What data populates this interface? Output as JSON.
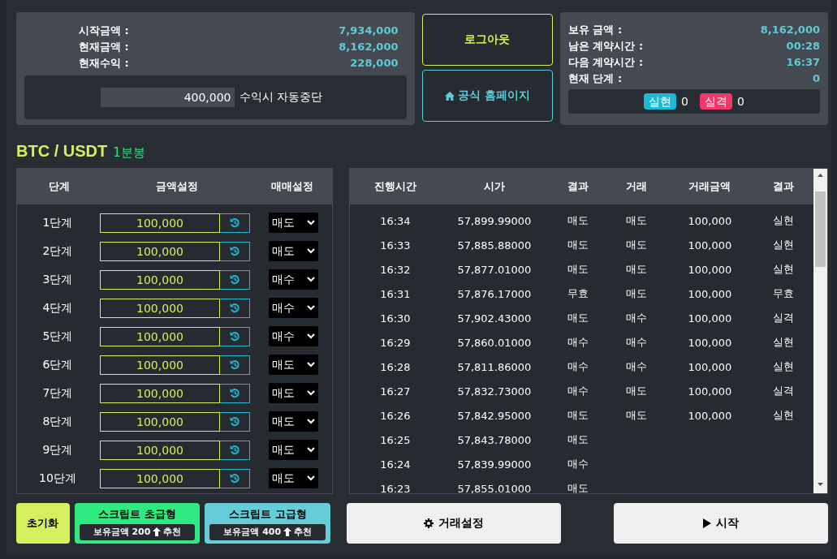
{
  "summary": {
    "rows": [
      {
        "label": "시작금액 :",
        "value": "7,934,000"
      },
      {
        "label": "현재금액 :",
        "value": "8,162,000"
      },
      {
        "label": "현재수익 :",
        "value": "228,000"
      }
    ],
    "auto_stop": {
      "value": "400,000",
      "label": "수익시 자동중단"
    }
  },
  "actions": {
    "logout": "로그아웃",
    "homepage": "공식 홈페이지"
  },
  "status": {
    "rows": [
      {
        "label": "보유 금액 :",
        "value": "8,162,000"
      },
      {
        "label": "남은 계약시간 :",
        "value": "00:28"
      },
      {
        "label": "다음 계약시간 :",
        "value": "16:37"
      },
      {
        "label": "현재 단계 :",
        "value": "0"
      }
    ],
    "badges": [
      {
        "label": "실현",
        "count": "0",
        "color": "#1eb9d2"
      },
      {
        "label": "실격",
        "count": "0",
        "color": "#f2386a"
      }
    ]
  },
  "pair": {
    "symbol": "BTC / USDT",
    "interval": "1분봉"
  },
  "steps": {
    "columns": [
      "단계",
      "금액설정",
      "매매설정"
    ],
    "rows": [
      {
        "step": "1단계",
        "amount": "100,000",
        "trade": "매도"
      },
      {
        "step": "2단계",
        "amount": "100,000",
        "trade": "매도"
      },
      {
        "step": "3단계",
        "amount": "100,000",
        "trade": "매수"
      },
      {
        "step": "4단계",
        "amount": "100,000",
        "trade": "매수"
      },
      {
        "step": "5단계",
        "amount": "100,000",
        "trade": "매수"
      },
      {
        "step": "6단계",
        "amount": "100,000",
        "trade": "매도"
      },
      {
        "step": "7단계",
        "amount": "100,000",
        "trade": "매도"
      },
      {
        "step": "8단계",
        "amount": "100,000",
        "trade": "매도"
      },
      {
        "step": "9단계",
        "amount": "100,000",
        "trade": "매도"
      },
      {
        "step": "10단계",
        "amount": "100,000",
        "trade": "매도"
      }
    ]
  },
  "history": {
    "columns": [
      "진행시간",
      "시가",
      "결과",
      "거래",
      "거래금액",
      "결과"
    ],
    "rows": [
      [
        "16:34",
        "57,899.99000",
        "매도",
        "매도",
        "100,000",
        "실현"
      ],
      [
        "16:33",
        "57,885.88000",
        "매도",
        "매도",
        "100,000",
        "실현"
      ],
      [
        "16:32",
        "57,877.01000",
        "매도",
        "매도",
        "100,000",
        "실현"
      ],
      [
        "16:31",
        "57,876.17000",
        "무효",
        "매도",
        "100,000",
        "무효"
      ],
      [
        "16:30",
        "57,902.43000",
        "매도",
        "매수",
        "100,000",
        "실격"
      ],
      [
        "16:29",
        "57,860.01000",
        "매수",
        "매수",
        "100,000",
        "실현"
      ],
      [
        "16:28",
        "57,811.86000",
        "매수",
        "매수",
        "100,000",
        "실현"
      ],
      [
        "16:27",
        "57,832.73000",
        "매수",
        "매도",
        "100,000",
        "실격"
      ],
      [
        "16:26",
        "57,842.95000",
        "매도",
        "매도",
        "100,000",
        "실현"
      ],
      [
        "16:25",
        "57,843.78000",
        "매도"
      ],
      [
        "16:24",
        "57,839.99000",
        "매수"
      ],
      [
        "16:23",
        "57,855.01000",
        "매도"
      ]
    ]
  },
  "footer": {
    "reset": "초기화",
    "scripts": [
      {
        "kind": "basic",
        "title": "스크립트 초급형",
        "note": "보유금액 200",
        "suffix": "추천"
      },
      {
        "kind": "advanced",
        "title": "스크립트 고급형",
        "note": "보유금액 400",
        "suffix": "추천"
      }
    ],
    "settings": "거래설정",
    "start": "시작"
  }
}
